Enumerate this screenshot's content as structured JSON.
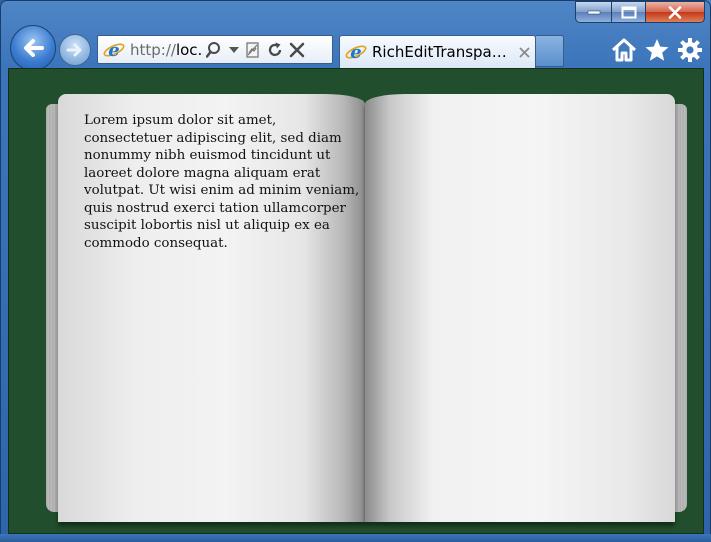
{
  "browser": {
    "address": {
      "url_prefix": "http://",
      "url_host": "loc...",
      "icon": "ie-logo-icon"
    },
    "tab": {
      "title": "RichEditTransparent...",
      "icon": "ie-logo-icon"
    },
    "icons": [
      "back-arrow-icon",
      "forward-arrow-icon",
      "search-icon",
      "dropdown-icon",
      "compat-view-icon",
      "refresh-icon",
      "stop-icon",
      "close-tab-icon",
      "home-icon",
      "favorites-star-icon",
      "settings-gear-icon"
    ],
    "colors": {
      "content_background": "#214f2d",
      "chrome": "#3d75bb"
    }
  },
  "book": {
    "left_page_text": "Lorem ipsum dolor sit amet, consectetuer adipiscing elit, sed diam nonummy nibh euismod tincidunt ut laoreet dolore magna aliquam erat volutpat. Ut wisi enim ad minim veniam, quis nostrud exerci tation ullamcorper suscipit lobortis nisl ut aliquip ex ea commodo consequat.",
    "right_page_text": ""
  }
}
